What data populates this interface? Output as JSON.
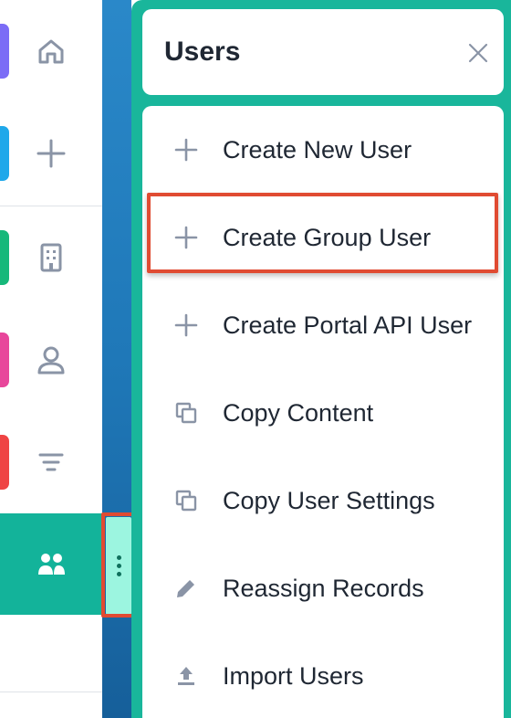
{
  "rail": {
    "items": [
      {
        "icon": "home-icon",
        "color": "#7b6cf6"
      },
      {
        "icon": "plus-icon",
        "color": "#1fa8ea"
      },
      {
        "icon": "building-icon",
        "color": "#16b87a"
      },
      {
        "icon": "user-icon",
        "color": "#e8469b"
      },
      {
        "icon": "filter-icon",
        "color": "#ef4444"
      },
      {
        "icon": "users-icon",
        "color": "#13b39a",
        "active": true
      }
    ]
  },
  "drawer": {
    "title": "Users",
    "close_icon": "close-icon",
    "items": [
      {
        "icon": "plus-icon",
        "label": "Create New User"
      },
      {
        "icon": "plus-icon",
        "label": "Create Group User",
        "highlighted": true
      },
      {
        "icon": "plus-icon",
        "label": "Create Portal API User"
      },
      {
        "icon": "copy-icon",
        "label": "Copy Content"
      },
      {
        "icon": "copy-icon",
        "label": "Copy User Settings"
      },
      {
        "icon": "pencil-icon",
        "label": "Reassign Records"
      },
      {
        "icon": "upload-icon",
        "label": "Import Users"
      }
    ]
  },
  "colors": {
    "accent_teal": "#19b69b",
    "highlight_red": "#e04b32",
    "icon_gray": "#8a94a6",
    "text_dark": "#1f2733"
  }
}
